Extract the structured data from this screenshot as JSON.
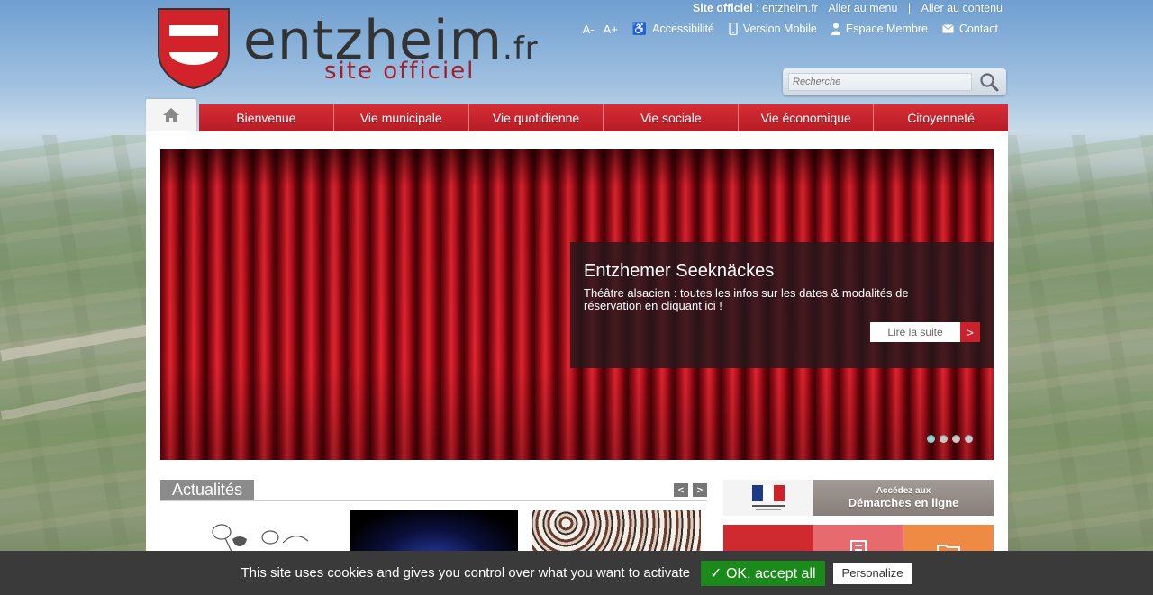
{
  "header": {
    "logo_name": "entzheim",
    "logo_tld": ".fr",
    "logo_sub": "site officiel",
    "top_links": {
      "site_label": "Site officiel",
      "site_value": " : entzheim.fr",
      "menu_link": "Aller au menu",
      "separator": "|",
      "content_link": "Aller au contenu"
    },
    "tools": {
      "font_decrease": "A-",
      "font_increase": "A+",
      "accessibility": "Accessibilité",
      "mobile": "Version Mobile",
      "member": "Espace Membre",
      "contact": "Contact"
    },
    "search": {
      "placeholder": "Recherche"
    }
  },
  "nav": {
    "items": [
      {
        "label": "Bienvenue"
      },
      {
        "label": "Vie municipale"
      },
      {
        "label": "Vie quotidienne"
      },
      {
        "label": "Vie sociale"
      },
      {
        "label": "Vie économique"
      },
      {
        "label": "Citoyenneté"
      }
    ]
  },
  "slider": {
    "title": "Entzhemer Seeknäckes",
    "text": "Théâtre alsacien : toutes les infos sur les dates & modalités de réservation en cliquant ici !",
    "read_more": "Lire la suite",
    "read_more_arrow": ">",
    "dots": 4,
    "active_dot": 0
  },
  "news": {
    "title": "Actualités",
    "prev": "<",
    "next": ">"
  },
  "demarches": {
    "small": "Accédez aux",
    "big": "Démarches en ligne"
  },
  "cookie": {
    "text": "This site uses cookies and gives you control over what you want to activate",
    "ok": "✓ OK, accept all",
    "personalize": "Personalize"
  },
  "colors": {
    "brand_red": "#c9222c",
    "cookie_bg": "#3a3a3a",
    "ok_green": "#1a8a1a"
  }
}
